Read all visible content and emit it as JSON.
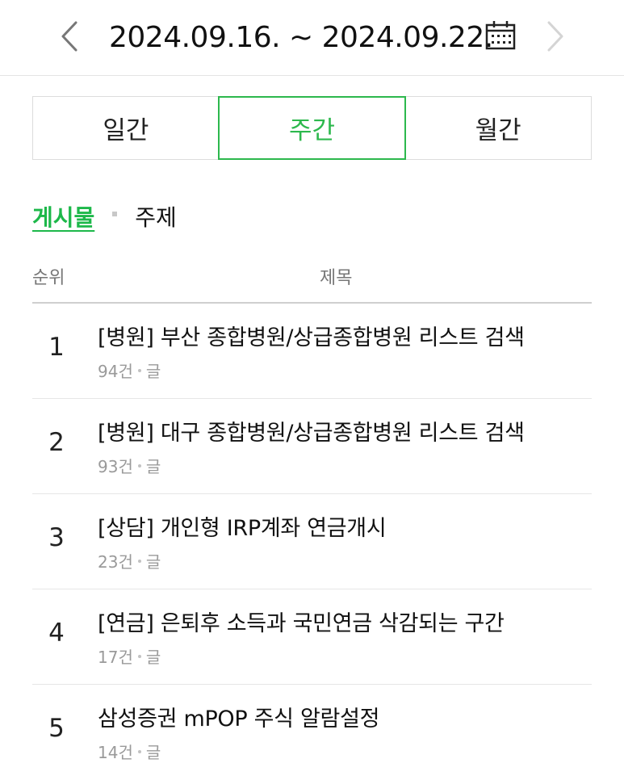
{
  "header": {
    "date_range": "2024.09.16. ~ 2024.09.22.",
    "prev_icon": "chevron-left-icon",
    "next_icon": "chevron-right-icon",
    "calendar_icon": "calendar-icon"
  },
  "period_tabs": [
    {
      "label": "일간",
      "active": false
    },
    {
      "label": "주간",
      "active": true
    },
    {
      "label": "월간",
      "active": false
    }
  ],
  "sub_tabs": [
    {
      "label": "게시물",
      "active": true
    },
    {
      "label": "주제",
      "active": false
    }
  ],
  "table": {
    "col_rank": "순위",
    "col_title": "제목"
  },
  "items": [
    {
      "rank": "1",
      "title": "[병원] 부산 종합병원/상급종합병원 리스트 검색",
      "count": "94건",
      "type": "글"
    },
    {
      "rank": "2",
      "title": "[병원] 대구 종합병원/상급종합병원 리스트 검색",
      "count": "93건",
      "type": "글"
    },
    {
      "rank": "3",
      "title": "[상담] 개인형 IRP계좌 연금개시",
      "count": "23건",
      "type": "글"
    },
    {
      "rank": "4",
      "title": "[연금] 은퇴후 소득과 국민연금 삭감되는 구간",
      "count": "17건",
      "type": "글"
    },
    {
      "rank": "5",
      "title": "삼성증권 mPOP 주식 알람설정",
      "count": "14건",
      "type": "글"
    }
  ],
  "colors": {
    "accent": "#2db84d",
    "text": "#111111",
    "muted": "#9a9a9a",
    "border": "#dcdcdc"
  }
}
